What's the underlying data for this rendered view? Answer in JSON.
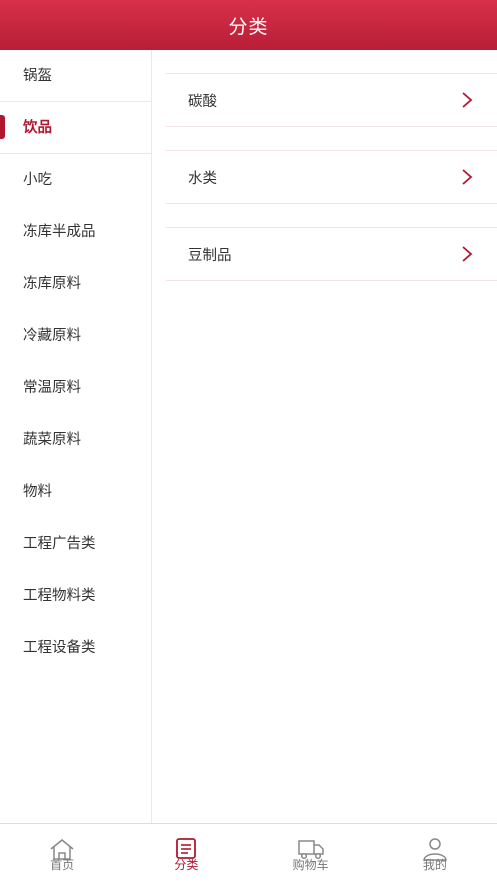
{
  "header": {
    "title": "分类"
  },
  "colors": {
    "accent": "#b0182f",
    "header_top": "#d8304a",
    "header_bottom": "#b81e36",
    "divider": "#f5e4e6"
  },
  "sidebar": {
    "items": [
      {
        "label": "锅盔",
        "active": false
      },
      {
        "label": "饮品",
        "active": true
      },
      {
        "label": "小吃",
        "active": false
      },
      {
        "label": "冻库半成品",
        "active": false
      },
      {
        "label": "冻库原料",
        "active": false
      },
      {
        "label": "冷藏原料",
        "active": false
      },
      {
        "label": "常温原料",
        "active": false
      },
      {
        "label": "蔬菜原料",
        "active": false
      },
      {
        "label": "物料",
        "active": false
      },
      {
        "label": "工程广告类",
        "active": false
      },
      {
        "label": "工程物料类",
        "active": false
      },
      {
        "label": "工程设备类",
        "active": false
      }
    ]
  },
  "subcategories": [
    {
      "label": "碳酸",
      "icon": "chevron-right-icon"
    },
    {
      "label": "水类",
      "icon": "chevron-right-icon"
    },
    {
      "label": "豆制品",
      "icon": "chevron-right-icon"
    }
  ],
  "tabbar": {
    "tabs": [
      {
        "label": "首页",
        "icon": "home-icon",
        "active": false
      },
      {
        "label": "分类",
        "icon": "category-list-icon",
        "active": true
      },
      {
        "label": "购物车",
        "icon": "delivery-truck-icon",
        "active": false
      },
      {
        "label": "我的",
        "icon": "user-profile-icon",
        "active": false
      }
    ]
  }
}
